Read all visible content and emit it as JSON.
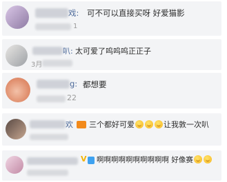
{
  "comments": [
    {
      "name_tail": "戏:",
      "text": "可不可以直接买呀 好爱猫影",
      "meta": "1"
    },
    {
      "name_tail": "叭:",
      "text": "太可爱了呜呜呜正正子",
      "meta": "3月"
    },
    {
      "name_tail": "g:",
      "text": "都想要",
      "meta": "22"
    },
    {
      "name_tail": "欢",
      "text_a": "三个都好可爱",
      "text_b": "让我敦一次叭"
    },
    {
      "name_tail": "",
      "text": "啊啊啊啊啊啊啊啊啊啊 好像赛"
    }
  ],
  "colors": {
    "name": "#4d6a9a",
    "text": "#2c2c2c",
    "row_bg": "#f3f4f6"
  }
}
